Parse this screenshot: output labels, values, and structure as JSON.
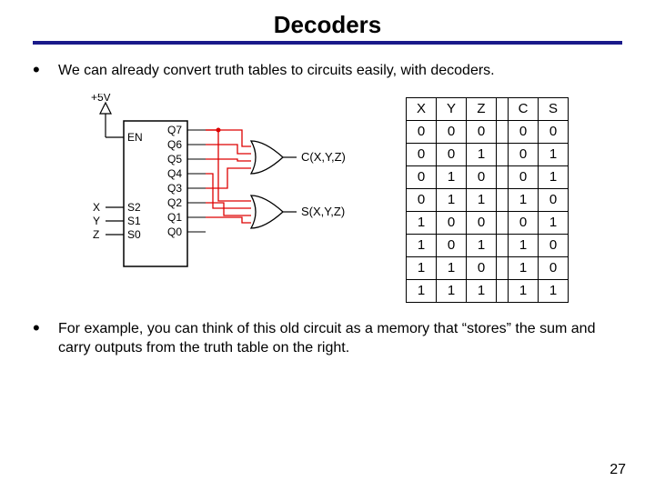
{
  "title": "Decoders",
  "bullets": {
    "b1": "We can already convert truth tables to circuits easily, with decoders.",
    "b2": "For example, you can think of this old circuit as a memory that “stores” the sum and carry outputs from the truth table on the right."
  },
  "circuit": {
    "vcc": "+5V",
    "enable": "EN",
    "inputs": [
      "X",
      "Y",
      "Z"
    ],
    "select_pins": [
      "S2",
      "S1",
      "S0"
    ],
    "outputs": [
      "Q7",
      "Q6",
      "Q5",
      "Q4",
      "Q3",
      "Q2",
      "Q1",
      "Q0"
    ],
    "gate_labels": {
      "c": "C(X,Y,Z)",
      "s": "S(X,Y,Z)"
    }
  },
  "truth_table": {
    "headers": [
      "X",
      "Y",
      "Z",
      "C",
      "S"
    ],
    "rows": [
      [
        0,
        0,
        0,
        0,
        0
      ],
      [
        0,
        0,
        1,
        0,
        1
      ],
      [
        0,
        1,
        0,
        0,
        1
      ],
      [
        0,
        1,
        1,
        1,
        0
      ],
      [
        1,
        0,
        0,
        0,
        1
      ],
      [
        1,
        0,
        1,
        1,
        0
      ],
      [
        1,
        1,
        0,
        1,
        0
      ],
      [
        1,
        1,
        1,
        1,
        1
      ]
    ]
  },
  "page_number": "27"
}
